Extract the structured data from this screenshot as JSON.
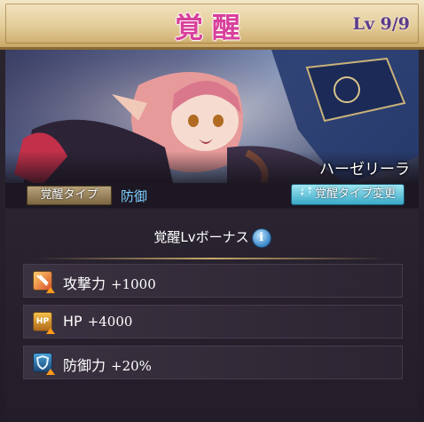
{
  "header": {
    "title": "覚醒",
    "level": "Lv 9/9"
  },
  "character": {
    "name": "ハーゼリーラ"
  },
  "awakening": {
    "type_label": "覚醒タイプ",
    "type_value": "防御",
    "change_button": "覚醒タイプ変更"
  },
  "bonus": {
    "heading": "覚醒Lvボーナス",
    "info_icon": "info-icon",
    "items": [
      {
        "label": "攻撃力",
        "value": "+1000",
        "icon": "attack-icon"
      },
      {
        "label": "HP",
        "value": "+4000",
        "icon": "hp-icon"
      },
      {
        "label": "防御力",
        "value": "+20%",
        "icon": "defense-icon"
      }
    ]
  },
  "colors": {
    "title": "#d8409a",
    "level": "#5b3a8a",
    "type_value": "#7fd0ff",
    "change_button": "#3aa8c8"
  }
}
